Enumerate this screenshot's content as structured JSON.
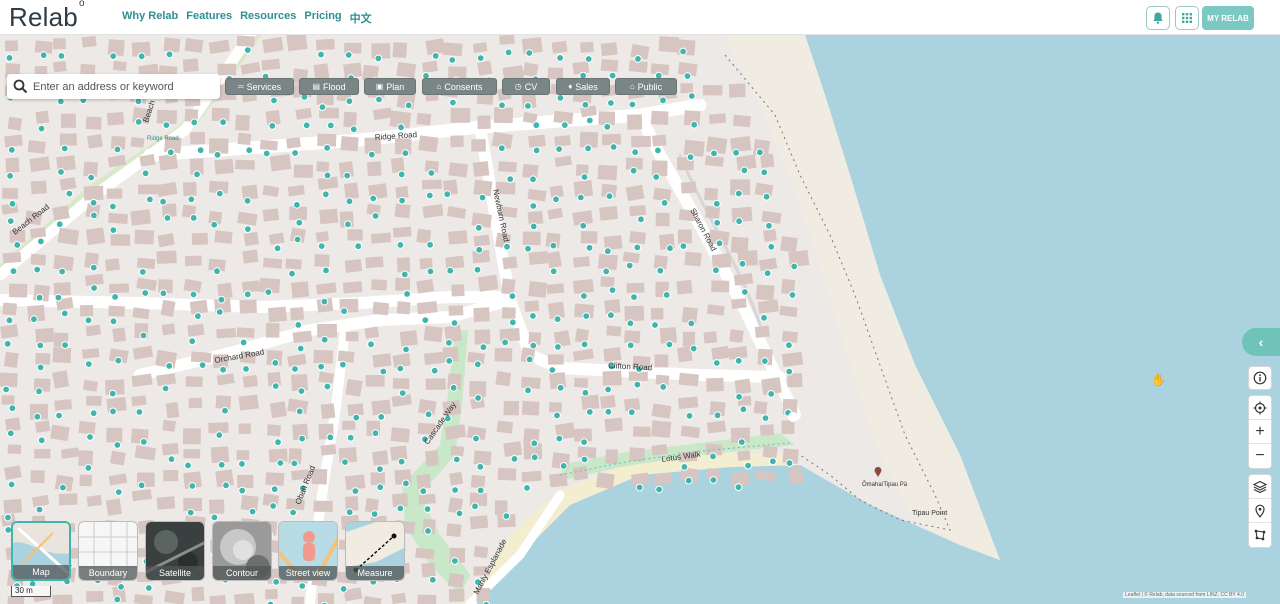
{
  "header": {
    "logo": "Relab",
    "logo_mark": "o",
    "nav": [
      "Why Relab",
      "Features",
      "Resources",
      "Pricing",
      "中文"
    ],
    "my_relab": "MY RELAB"
  },
  "search": {
    "placeholder": "Enter an address or keyword"
  },
  "layer_buttons": [
    {
      "label": "Services",
      "icon": "lines-icon"
    },
    {
      "label": "Flood",
      "icon": "flood-icon"
    },
    {
      "label": "Plan",
      "icon": "plan-icon"
    },
    {
      "label": "Consents",
      "icon": "consents-icon"
    },
    {
      "label": "CV",
      "icon": "cv-icon"
    },
    {
      "label": "Sales",
      "icon": "sales-icon"
    },
    {
      "label": "Public",
      "icon": "public-icon"
    }
  ],
  "map": {
    "roads": [
      "Ridge Road",
      "Orchard Road",
      "Clifton Road",
      "Sharon Road",
      "Newburn Road",
      "Beach Road",
      "Oban Road",
      "Lotus Walk",
      "Cascade Way",
      "Manly Esplanade",
      "Beach R..."
    ],
    "places": [
      "Ridge Road",
      "Ōmaha/Tipau Pā",
      "Tipau Point"
    ],
    "colors": {
      "water": "#aad3df",
      "land": "#ece9e6",
      "road": "#ffffff",
      "building": "#d7c5c2",
      "marker": "#3fb5ad",
      "beach": "#f3eed0",
      "park": "#c8e8c8"
    }
  },
  "basemaps": [
    {
      "label": "Map",
      "active": true
    },
    {
      "label": "Boundary",
      "active": false
    },
    {
      "label": "Satellite",
      "active": false
    },
    {
      "label": "Contour",
      "active": false
    },
    {
      "label": "Street view",
      "active": false
    },
    {
      "label": "Measure",
      "active": false
    }
  ],
  "scale": "30 m",
  "attribution": "Leaflet | © Relab, data sourced from LINZ, CC BY 4.0"
}
